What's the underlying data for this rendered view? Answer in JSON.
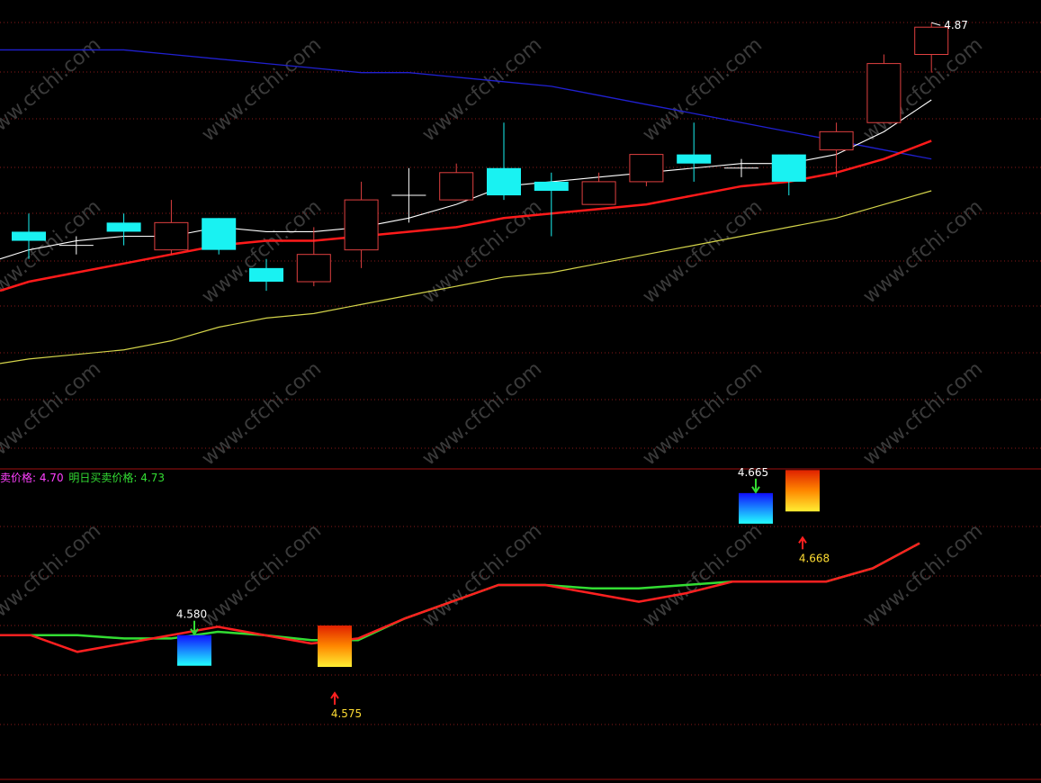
{
  "colors": {
    "background": "#000000",
    "grid": "#8a1a1a",
    "up_candle": "#e04040",
    "down_candle": "#19f2f2",
    "ma_white": "#ffffff",
    "ma_red": "#ff1a1a",
    "ma_yellow": "#d4d44a",
    "ma_blue": "#2020d0",
    "buy_line": "#ff2020",
    "sell_line": "#33dd33",
    "label_magenta": "#ff40ff",
    "label_green": "#33dd33",
    "label_white": "#ffffff",
    "label_yellow": "#ffdd33"
  },
  "header": {
    "sell_label": "卖价格: ",
    "sell_value": "4.70",
    "buy_label": "明日买卖价格: ",
    "buy_value": "4.73"
  },
  "watermark": "www.cfchi.com",
  "chart_data": [
    {
      "type": "candlestick",
      "price_range": [
        3.9,
        4.9
      ],
      "high_label": "4.87",
      "candles": [
        {
          "o": 4.41,
          "h": 4.45,
          "l": 4.35,
          "c": 4.39
        },
        {
          "o": 4.38,
          "h": 4.4,
          "l": 4.36,
          "c": 4.38
        },
        {
          "o": 4.43,
          "h": 4.45,
          "l": 4.38,
          "c": 4.41
        },
        {
          "o": 4.37,
          "h": 4.48,
          "l": 4.36,
          "c": 4.43
        },
        {
          "o": 4.44,
          "h": 4.44,
          "l": 4.36,
          "c": 4.37
        },
        {
          "o": 4.33,
          "h": 4.35,
          "l": 4.28,
          "c": 4.3
        },
        {
          "o": 4.3,
          "h": 4.42,
          "l": 4.29,
          "c": 4.36
        },
        {
          "o": 4.37,
          "h": 4.52,
          "l": 4.33,
          "c": 4.48
        },
        {
          "o": 4.49,
          "h": 4.55,
          "l": 4.43,
          "c": 4.49
        },
        {
          "o": 4.48,
          "h": 4.56,
          "l": 4.48,
          "c": 4.54
        },
        {
          "o": 4.55,
          "h": 4.65,
          "l": 4.48,
          "c": 4.49
        },
        {
          "o": 4.52,
          "h": 4.54,
          "l": 4.4,
          "c": 4.5
        },
        {
          "o": 4.47,
          "h": 4.54,
          "l": 4.47,
          "c": 4.52
        },
        {
          "o": 4.52,
          "h": 4.58,
          "l": 4.51,
          "c": 4.58
        },
        {
          "o": 4.58,
          "h": 4.65,
          "l": 4.52,
          "c": 4.56
        },
        {
          "o": 4.55,
          "h": 4.57,
          "l": 4.53,
          "c": 4.55
        },
        {
          "o": 4.58,
          "h": 4.58,
          "l": 4.49,
          "c": 4.52
        },
        {
          "o": 4.59,
          "h": 4.65,
          "l": 4.53,
          "c": 4.63
        },
        {
          "o": 4.65,
          "h": 4.8,
          "l": 4.65,
          "c": 4.78
        },
        {
          "o": 4.8,
          "h": 4.87,
          "l": 4.76,
          "c": 4.86
        }
      ],
      "ma_white": [
        4.37,
        4.39,
        4.4,
        4.4,
        4.42,
        4.41,
        4.41,
        4.42,
        4.44,
        4.47,
        4.51,
        4.52,
        4.53,
        4.54,
        4.55,
        4.56,
        4.56,
        4.58,
        4.63,
        4.7
      ],
      "ma_red": [
        4.3,
        4.32,
        4.34,
        4.36,
        4.38,
        4.39,
        4.39,
        4.4,
        4.41,
        4.42,
        4.44,
        4.45,
        4.46,
        4.47,
        4.49,
        4.51,
        4.52,
        4.54,
        4.57,
        4.61
      ],
      "ma_yellow": [
        4.13,
        4.14,
        4.15,
        4.17,
        4.2,
        4.22,
        4.23,
        4.25,
        4.27,
        4.29,
        4.31,
        4.32,
        4.34,
        4.36,
        4.38,
        4.4,
        4.42,
        4.44,
        4.47,
        4.5
      ],
      "ma_blue": [
        4.81,
        4.81,
        4.81,
        4.8,
        4.79,
        4.78,
        4.77,
        4.76,
        4.76,
        4.75,
        4.74,
        4.73,
        4.71,
        4.69,
        4.67,
        4.65,
        4.63,
        4.61,
        4.59,
        4.57
      ]
    },
    {
      "type": "line",
      "series": [
        {
          "color": "buy_line",
          "values": [
            4.58,
            4.58,
            4.57,
            4.575,
            4.58,
            4.585,
            4.58,
            4.575,
            4.578,
            4.59,
            4.6,
            4.61,
            4.61,
            4.605,
            4.6,
            4.605,
            4.612,
            4.612,
            4.612,
            4.62,
            4.635
          ]
        },
        {
          "color": "sell_line",
          "values": [
            4.58,
            4.58,
            4.58,
            4.578,
            4.578,
            4.582,
            4.58,
            4.577,
            4.577,
            4.59,
            4.6,
            4.61,
            4.61,
            4.608,
            4.608,
            4.61,
            4.612,
            4.612,
            4.612,
            4.62,
            4.635
          ]
        }
      ],
      "markers": [
        {
          "label": "4.580",
          "kind": "sell",
          "index": 4.5
        },
        {
          "label": "4.575",
          "kind": "buy",
          "index": 7.5
        },
        {
          "label": "4.665",
          "kind": "sell",
          "index": 16.5
        },
        {
          "label": "4.668",
          "kind": "buy",
          "index": 17.5
        }
      ]
    }
  ]
}
